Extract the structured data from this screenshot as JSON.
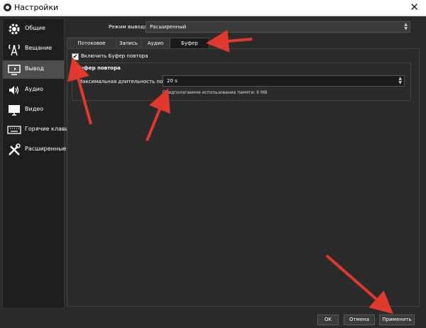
{
  "window": {
    "title": "Настройки"
  },
  "sidebar": {
    "items": [
      {
        "label": "Общие",
        "icon": "gear-icon"
      },
      {
        "label": "Вещание",
        "icon": "broadcast-icon"
      },
      {
        "label": "Вывод",
        "icon": "monitor-output-icon"
      },
      {
        "label": "Аудио",
        "icon": "speaker-icon"
      },
      {
        "label": "Видео",
        "icon": "display-icon"
      },
      {
        "label": "Горячие клавиши",
        "icon": "keyboard-icon"
      },
      {
        "label": "Расширенные",
        "icon": "tools-icon"
      }
    ],
    "active_index": 2
  },
  "output": {
    "mode_label": "Режим вывода",
    "mode_value": "Расширенный"
  },
  "tabs": [
    {
      "label": "Потоковое вещание"
    },
    {
      "label": "Запись"
    },
    {
      "label": "Аудио"
    },
    {
      "label": "Буфер повтора"
    }
  ],
  "active_tab_index": 3,
  "replay": {
    "enable_label": "Включить Буфер повтора",
    "enabled": true,
    "group_title": "Буфер повтора",
    "max_duration_label": "Максимальная длительность повтора",
    "max_duration_value": "20 s",
    "memory_text": "Предполагаемое использование памяти: 6 MB"
  },
  "buttons": {
    "ok": "OK",
    "cancel": "Отмена",
    "apply": "Применить"
  },
  "colors": {
    "annotation_arrow": "#e0392e",
    "window_bg": "#2b2b2b",
    "active_item": "#4d4d4d"
  }
}
